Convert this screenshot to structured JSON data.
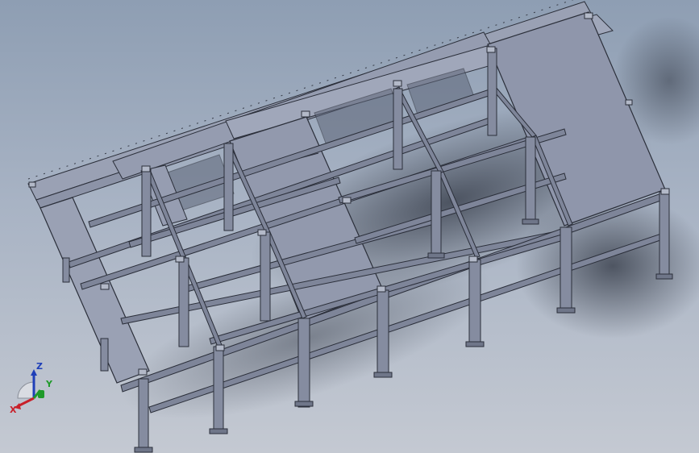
{
  "viewport": {
    "description_colors": {
      "background_top": "#8e9eb3",
      "background_bottom": "#c4c9d2",
      "panel_fill": "#8b92a8",
      "panel_edge": "#2b2f3a",
      "beam_fill": "#7e8599",
      "shadow": "#3c4250"
    }
  },
  "triad": {
    "x_label": "X",
    "y_label": "Y",
    "z_label": "Z",
    "x_color": "#c8202a",
    "y_color": "#1f9a2a",
    "z_color": "#1f3fb8"
  }
}
